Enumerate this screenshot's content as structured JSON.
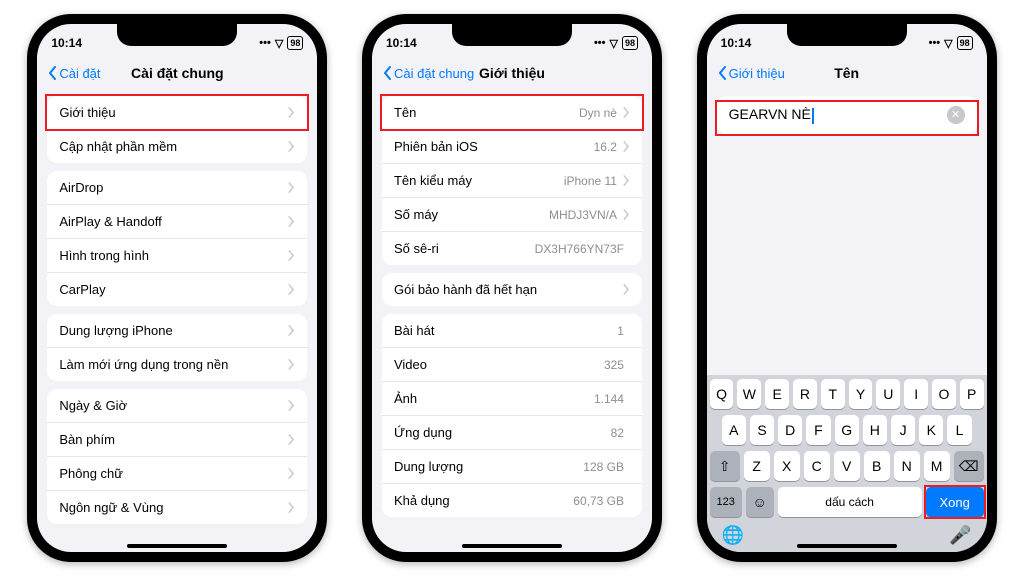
{
  "status": {
    "time": "10:14",
    "battery": "98"
  },
  "phones": [
    {
      "back": "Cài đặt",
      "title": "Cài đặt chung",
      "groups": [
        [
          {
            "label": "Giới thiệu",
            "chevron": true,
            "highlight": true
          },
          {
            "label": "Cập nhật phần mềm",
            "chevron": true
          }
        ],
        [
          {
            "label": "AirDrop",
            "chevron": true
          },
          {
            "label": "AirPlay & Handoff",
            "chevron": true
          },
          {
            "label": "Hình trong hình",
            "chevron": true
          },
          {
            "label": "CarPlay",
            "chevron": true
          }
        ],
        [
          {
            "label": "Dung lượng iPhone",
            "chevron": true
          },
          {
            "label": "Làm mới ứng dụng trong nền",
            "chevron": true
          }
        ],
        [
          {
            "label": "Ngày & Giờ",
            "chevron": true
          },
          {
            "label": "Bàn phím",
            "chevron": true
          },
          {
            "label": "Phông chữ",
            "chevron": true
          },
          {
            "label": "Ngôn ngữ & Vùng",
            "chevron": true
          }
        ]
      ]
    },
    {
      "back": "Cài đặt chung",
      "title": "Giới thiệu",
      "groups": [
        [
          {
            "label": "Tên",
            "value": "Dyn nè",
            "chevron": true,
            "highlight": true
          },
          {
            "label": "Phiên bản iOS",
            "value": "16.2",
            "chevron": true
          },
          {
            "label": "Tên kiểu máy",
            "value": "iPhone 11",
            "chevron": true
          },
          {
            "label": "Số máy",
            "value": "MHDJ3VN/A",
            "chevron": true
          },
          {
            "label": "Số sê-ri",
            "value": "DX3H766YN73F"
          }
        ],
        [
          {
            "label": "Gói bảo hành đã hết hạn",
            "chevron": true
          }
        ],
        [
          {
            "label": "Bài hát",
            "value": "1"
          },
          {
            "label": "Video",
            "value": "325"
          },
          {
            "label": "Ảnh",
            "value": "1.144"
          },
          {
            "label": "Ứng dụng",
            "value": "82"
          },
          {
            "label": "Dung lượng",
            "value": "128 GB"
          },
          {
            "label": "Khả dụng",
            "value": "60,73 GB"
          }
        ]
      ]
    },
    {
      "back": "Giới thiệu",
      "title": "Tên",
      "input_value": "GEARVN NÈ",
      "keyboard": {
        "rows": [
          [
            "Q",
            "W",
            "E",
            "R",
            "T",
            "Y",
            "U",
            "I",
            "O",
            "P"
          ],
          [
            "A",
            "S",
            "D",
            "F",
            "G",
            "H",
            "J",
            "K",
            "L"
          ],
          [
            "Z",
            "X",
            "C",
            "V",
            "B",
            "N",
            "M"
          ]
        ],
        "space": "dấu cách",
        "done": "Xong",
        "numkey": "123"
      }
    }
  ]
}
